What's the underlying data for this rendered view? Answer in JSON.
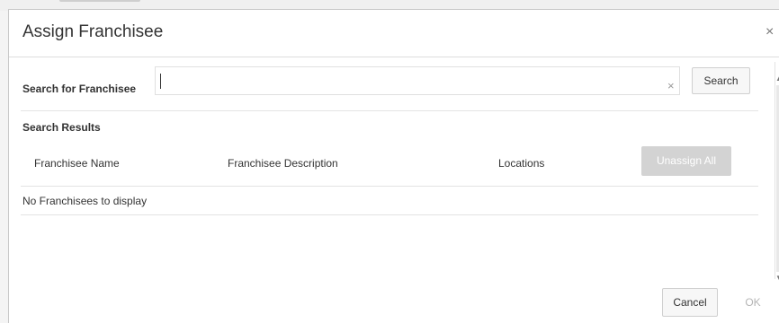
{
  "dialog": {
    "title": "Assign Franchisee",
    "close_icon": "close-icon"
  },
  "search": {
    "label": "Search for Franchisee",
    "value": "",
    "clear_label": "×",
    "button_label": "Search"
  },
  "results": {
    "label": "Search Results",
    "columns": [
      "Franchisee Name",
      "Franchisee Description",
      "Locations"
    ],
    "unassign_all_label": "Unassign All",
    "empty_message": "No Franchisees to display"
  },
  "footer": {
    "cancel_label": "Cancel",
    "ok_label": "OK"
  },
  "colors": {
    "disabled_button_bg": "#d3d3d3",
    "disabled_text": "#b5b5b5"
  }
}
